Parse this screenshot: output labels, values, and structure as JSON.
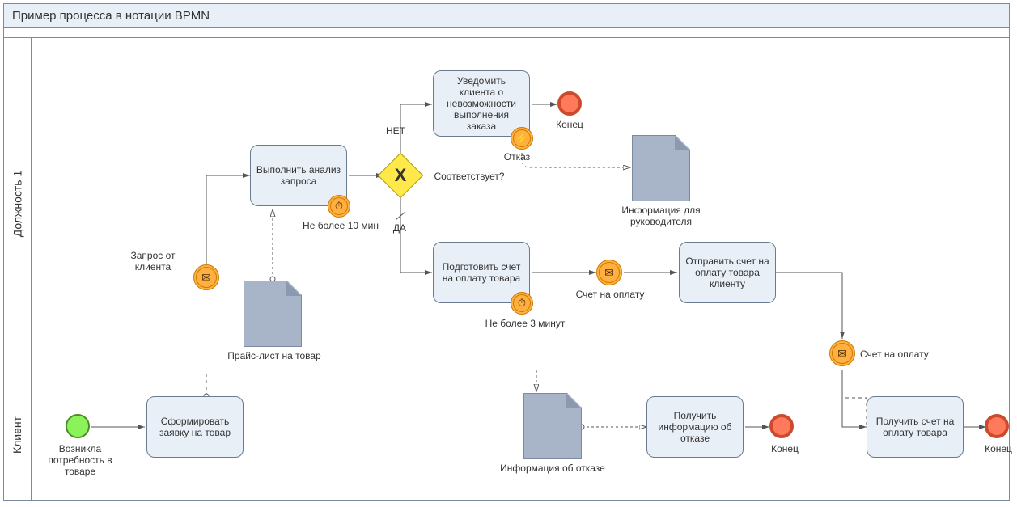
{
  "pool": {
    "title": "Пример процесса в нотации BPMN"
  },
  "lanes": {
    "lane1": "Должность 1",
    "lane2": "Клиент"
  },
  "events": {
    "start_label": "Возникла потребность в товаре",
    "msg_request_label": "Запрос от клиента",
    "msg_invoice_label": "Счет на оплату",
    "msg_invoice2_label": "Счет на оплату",
    "refusal_label": "Отказ",
    "end1_label": "Конец",
    "end2_label": "Конец",
    "end3_label": "Конец",
    "timer1_label": "Не более 10 мин",
    "timer2_label": "Не более 3 минут"
  },
  "tasks": {
    "form_request": "Сформировать заявку на товар",
    "analyze": "Выполнить анализ запроса",
    "notify": "Уведомить клиента о невозможности выполнения заказа",
    "prepare_invoice": "Подготовить счет на оплату товара",
    "send_invoice": "Отправить счет на оплату товара клиенту",
    "receive_refusal": "Получить информацию об отказе",
    "receive_invoice": "Получить счет на оплату товара"
  },
  "gateway": {
    "question": "Соответствует?",
    "no": "НЕТ",
    "yes": "ДА"
  },
  "docs": {
    "pricelist": "Прайс-лист на товар",
    "info_manager": "Информация для руководителя",
    "info_refusal": "Информация об отказе"
  }
}
